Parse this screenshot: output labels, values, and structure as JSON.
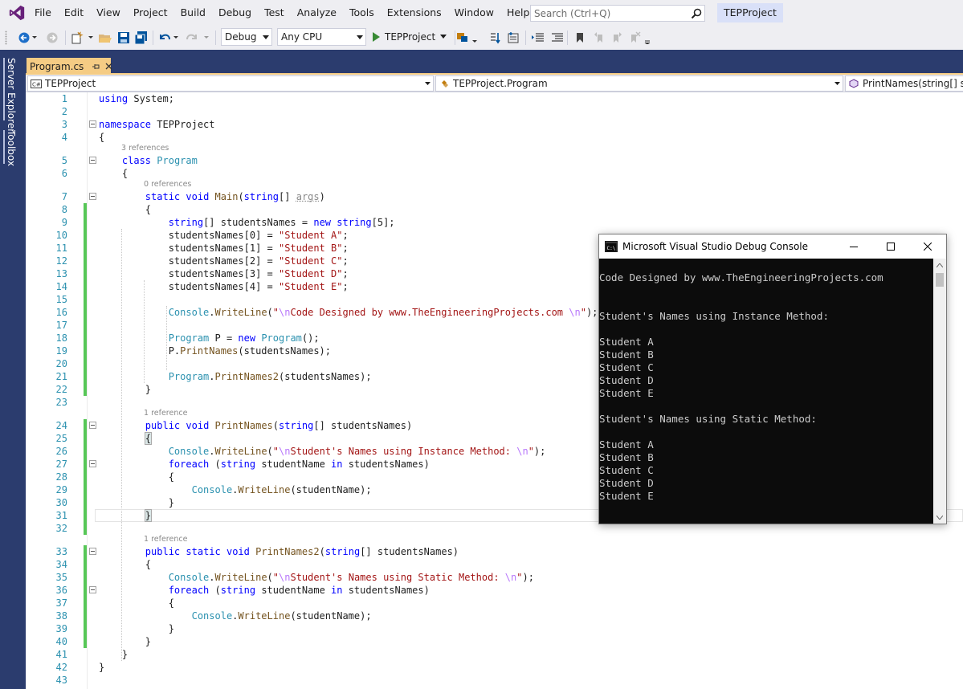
{
  "menu": {
    "items": [
      "File",
      "Edit",
      "View",
      "Project",
      "Build",
      "Debug",
      "Test",
      "Analyze",
      "Tools",
      "Extensions",
      "Window",
      "Help"
    ],
    "search_placeholder": "Search (Ctrl+Q)",
    "solution_name": "TEPProject"
  },
  "toolbar": {
    "config": "Debug",
    "platform": "Any CPU",
    "start_label": "TEPProject"
  },
  "side_tabs": [
    "Server Explorer",
    "Toolbox"
  ],
  "doc_tab": {
    "title": "Program.cs",
    "pin": "⊣",
    "close": "×"
  },
  "nav": {
    "project": "TEPProject",
    "class": "TEPProject.Program",
    "member": "PrintNames(string[] studentsNames)"
  },
  "codelens": {
    "program": "3 references",
    "main": "0 references",
    "printnames": "1 reference",
    "printnames2": "1 reference"
  },
  "code_lines": [
    "using System;",
    "",
    "namespace TEPProject",
    "{",
    "    class Program",
    "    {",
    "        static void Main(string[] args)",
    "        {",
    "            string[] studentsNames = new string[5];",
    "            studentsNames[0] = \"Student A\";",
    "            studentsNames[1] = \"Student B\";",
    "            studentsNames[2] = \"Student C\";",
    "            studentsNames[3] = \"Student D\";",
    "            studentsNames[4] = \"Student E\";",
    "",
    "            Console.WriteLine(\"\\nCode Designed by www.TheEngineeringProjects.com \\n\");",
    "",
    "            Program P = new Program();",
    "            P.PrintNames(studentsNames);",
    "",
    "            Program.PrintNames2(studentsNames);",
    "        }",
    "",
    "        public void PrintNames(string[] studentsNames)",
    "        {",
    "            Console.WriteLine(\"\\nStudent's Names using Instance Method: \\n\");",
    "            foreach (string studentName in studentsNames)",
    "            {",
    "                Console.WriteLine(studentName);",
    "            }",
    "        }",
    "",
    "        public static void PrintNames2(string[] studentsNames)",
    "        {",
    "            Console.WriteLine(\"\\nStudent's Names using Static Method: \\n\");",
    "            foreach (string studentName in studentsNames)",
    "            {",
    "                Console.WriteLine(studentName);",
    "            }",
    "        }",
    "    }",
    "}",
    ""
  ],
  "console": {
    "title": "Microsoft Visual Studio Debug Console",
    "lines": [
      "",
      "Code Designed by www.TheEngineeringProjects.com",
      "",
      "",
      "Student's Names using Instance Method:",
      "",
      "Student A",
      "Student B",
      "Student C",
      "Student D",
      "Student E",
      "",
      "Student's Names using Static Method:",
      "",
      "Student A",
      "Student B",
      "Student C",
      "Student D",
      "Student E"
    ]
  },
  "colors": {
    "accent_blue": "#2b3c6e",
    "tab_active": "#f5cc84",
    "keyword": "#0000ff",
    "type": "#2b91af",
    "string": "#a31515",
    "change_margin": "#57c757"
  }
}
